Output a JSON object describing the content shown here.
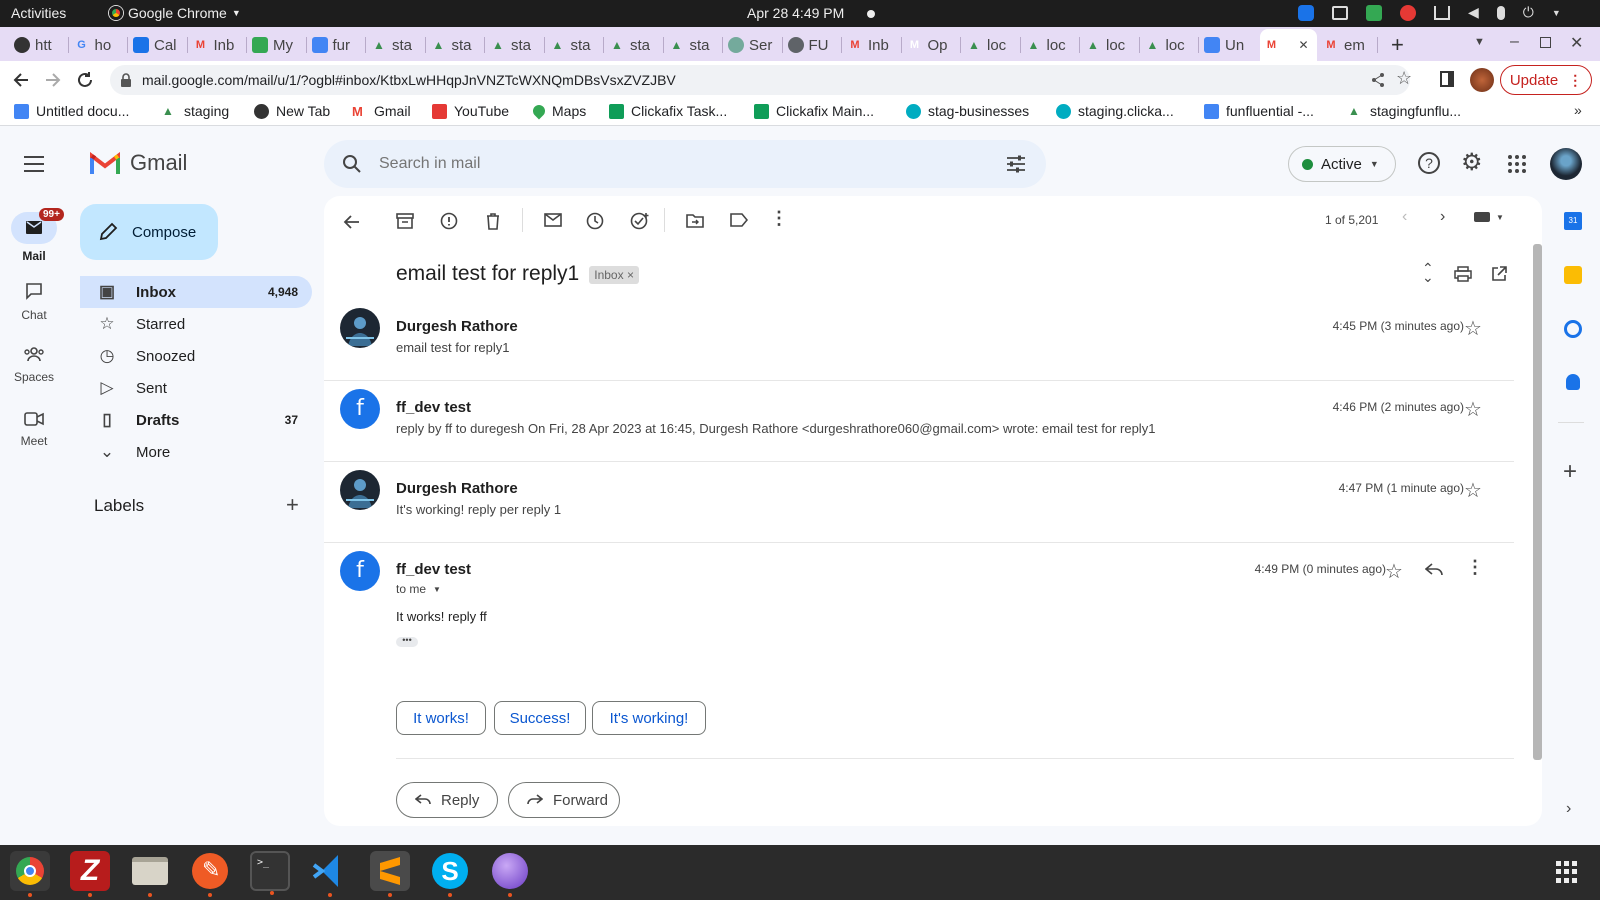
{
  "system": {
    "activities": "Activities",
    "app_name": "Google Chrome",
    "clock": "Apr 28  4:49 PM"
  },
  "tabs": [
    {
      "label": "htt",
      "icon": "github-icon"
    },
    {
      "label": "ho",
      "icon": "google-icon"
    },
    {
      "label": "Cal",
      "icon": "calendar-icon"
    },
    {
      "label": "Inb",
      "icon": "gmail-icon"
    },
    {
      "label": "My",
      "icon": "drive-icon"
    },
    {
      "label": "fur",
      "icon": "docs-icon"
    },
    {
      "label": "sta",
      "icon": "staging-icon"
    },
    {
      "label": "sta",
      "icon": "staging-icon"
    },
    {
      "label": "sta",
      "icon": "staging-icon"
    },
    {
      "label": "sta",
      "icon": "staging-icon"
    },
    {
      "label": "sta",
      "icon": "staging-icon"
    },
    {
      "label": "sta",
      "icon": "staging-icon"
    },
    {
      "label": "Ser",
      "icon": "openai-icon"
    },
    {
      "label": "FU",
      "icon": "globe-icon"
    },
    {
      "label": "Inb",
      "icon": "gmail-icon"
    },
    {
      "label": "Op",
      "icon": "medium-icon"
    },
    {
      "label": "loc",
      "icon": "staging-icon"
    },
    {
      "label": "loc",
      "icon": "staging-icon"
    },
    {
      "label": "loc",
      "icon": "staging-icon"
    },
    {
      "label": "loc",
      "icon": "staging-icon"
    },
    {
      "label": "Un",
      "icon": "docs-icon"
    },
    {
      "label": "",
      "icon": "gmail-icon",
      "active": true
    },
    {
      "label": "em",
      "icon": "gmail-icon"
    }
  ],
  "address_bar": {
    "url": "mail.google.com/mail/u/1/?ogbl#inbox/KtbxLwHHqpJnVNZTcWXNQmDBsVsxZVZJBV",
    "update_label": "Update"
  },
  "bookmarks": [
    {
      "label": "Untitled docu...",
      "icon": "docs-icon"
    },
    {
      "label": "staging",
      "icon": "staging-icon"
    },
    {
      "label": "New Tab",
      "icon": "globe-icon"
    },
    {
      "label": "Gmail",
      "icon": "gmail-icon"
    },
    {
      "label": "YouTube",
      "icon": "youtube-icon"
    },
    {
      "label": "Maps",
      "icon": "maps-icon"
    },
    {
      "label": "Clickafix Task...",
      "icon": "sheets-icon"
    },
    {
      "label": "Clickafix Main...",
      "icon": "sheets-icon"
    },
    {
      "label": "stag-businesses",
      "icon": "c-icon"
    },
    {
      "label": "staging.clicka...",
      "icon": "c-icon"
    },
    {
      "label": "funfluential -...",
      "icon": "docs-icon"
    },
    {
      "label": "stagingfunflu...",
      "icon": "staging-icon"
    }
  ],
  "gmail": {
    "brand": "Gmail",
    "search_placeholder": "Search in mail",
    "status": "Active",
    "compose": "Compose",
    "rail": [
      {
        "label": "Mail",
        "badge": "99+"
      },
      {
        "label": "Chat"
      },
      {
        "label": "Spaces"
      },
      {
        "label": "Meet"
      }
    ],
    "nav": [
      {
        "label": "Inbox",
        "count": "4,948"
      },
      {
        "label": "Starred",
        "count": ""
      },
      {
        "label": "Snoozed",
        "count": ""
      },
      {
        "label": "Sent",
        "count": ""
      },
      {
        "label": "Drafts",
        "count": "37"
      },
      {
        "label": "More",
        "count": ""
      }
    ],
    "labels_heading": "Labels",
    "pager": "1 of 5,201",
    "thread": {
      "subject": "email test for reply1",
      "label_chip": "Inbox",
      "messages": [
        {
          "sender": "Durgesh Rathore",
          "snippet": "email test for reply1",
          "time": "4:45 PM (3 minutes ago)"
        },
        {
          "sender": "ff_dev test",
          "snippet": "reply by ff to duregesh On Fri, 28 Apr 2023 at 16:45, Durgesh Rathore <durgeshrathore060@gmail.com> wrote: email test for reply1",
          "time": "4:46 PM (2 minutes ago)"
        },
        {
          "sender": "Durgesh Rathore",
          "snippet": "It's working! reply per reply 1",
          "time": "4:47 PM (1 minute ago)"
        },
        {
          "sender": "ff_dev test",
          "recipient": "to me",
          "body": "It works! reply ff",
          "time": "4:49 PM (0 minutes ago)"
        }
      ],
      "smart_replies": [
        "It works!",
        "Success!",
        "It's working!"
      ],
      "reply_label": "Reply",
      "forward_label": "Forward"
    }
  },
  "colors": {
    "accent": "#0b57d0",
    "selected_nav": "#d3e3fd",
    "compose_bg": "#c2e7ff",
    "badge": "#b3261e"
  }
}
